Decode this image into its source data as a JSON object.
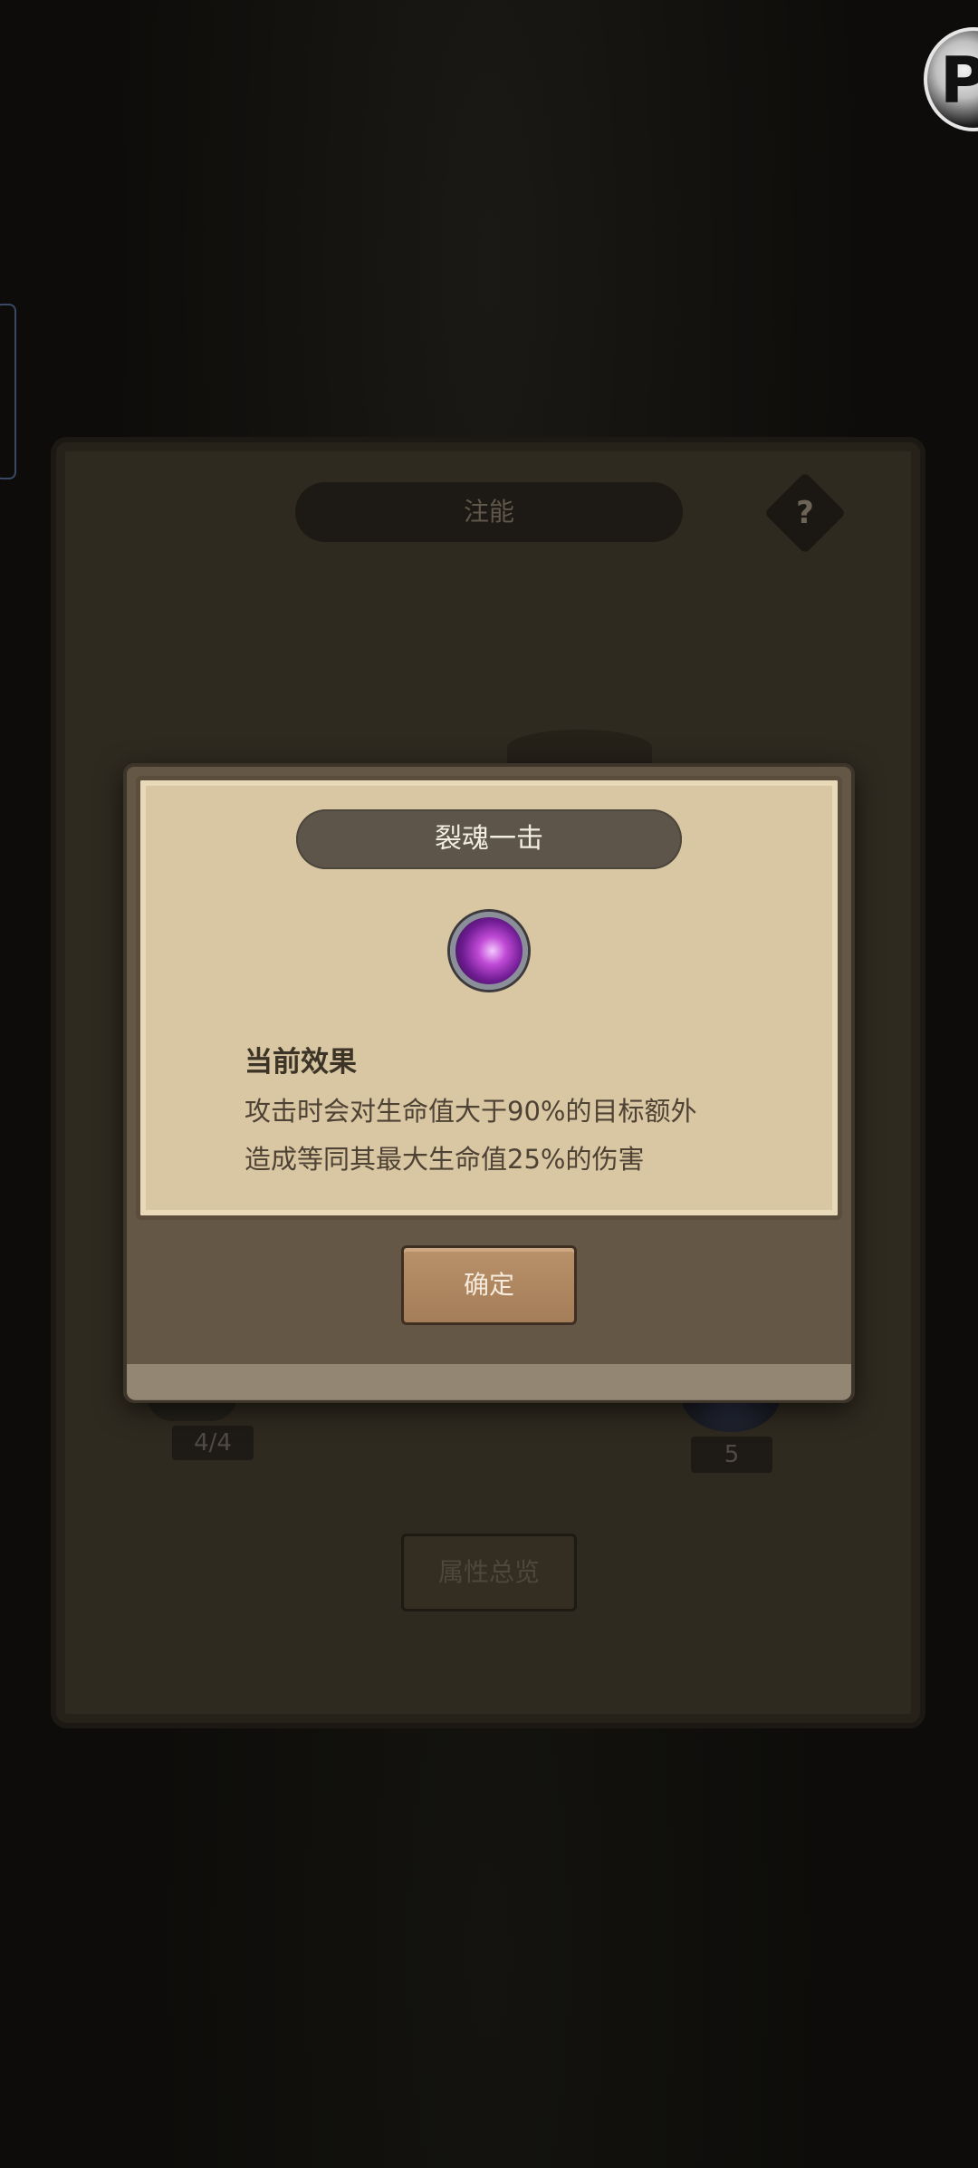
{
  "background_panel": {
    "title": "注能",
    "help_symbol": "?",
    "left_item_count": "4/4",
    "right_item_count": "5",
    "overview_button_label": "属性总览"
  },
  "popup": {
    "skill_name": "裂魂一击",
    "skill_icon": "purple-flame-orb-icon",
    "effect_heading": "当前效果",
    "effect_line1": "攻击时会对生命值大于90%的目标额外",
    "effect_line2": "造成等同其最大生命值25%的伤害",
    "confirm_label": "确定"
  },
  "colors": {
    "parchment": "#d9c6a2",
    "button_wood": "#b9916b",
    "dim_background": "#0d0c0a"
  }
}
